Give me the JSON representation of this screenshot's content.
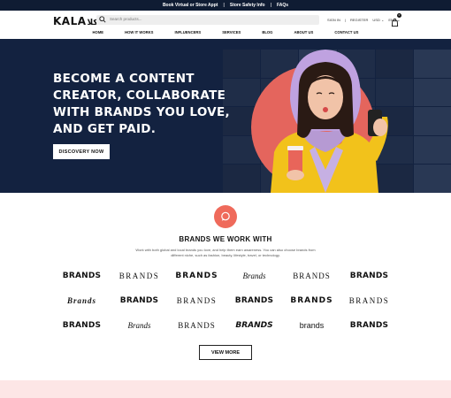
{
  "topbar": {
    "link1": "Book Virtual or Store Appt",
    "sep": "|",
    "link2": "Store Safety Info",
    "link3": "FAQs"
  },
  "header": {
    "logo": "KALA",
    "logo_arabic": "كلا",
    "search_placeholder": "Search products...",
    "signin": "SIGN IN",
    "register": "REGISTER",
    "currency": "USD ⌄",
    "language": "ENG ⌄",
    "cart_count": "0"
  },
  "nav": [
    "HOME",
    "HOW IT WORKS",
    "INFLUENCERS",
    "SERVICES",
    "BLOG",
    "ABOUT US",
    "CONTACT US"
  ],
  "hero": {
    "headline": "BECOME A CONTENT CREATOR, COLLABORATE WITH BRANDS YOU LOVE, AND GET PAID.",
    "button": "DISCOVERY NOW"
  },
  "brands_section": {
    "title": "BRANDS WE WORK WITH",
    "description": "Work with both global and local brands you love, and help them earn awareness. You can also choose brands from different niche, such as fashion, beauty, lifestyle, travel, or technology.",
    "logos": [
      "BRANDS",
      "BRANDS",
      "BRANDS",
      "Brands",
      "BRANDS",
      "BRANDS",
      "Brands",
      "BRANDS",
      "BRANDS",
      "BRANDS",
      "BRANDS",
      "BRANDS",
      "BRANDS",
      "Brands",
      "BRANDS",
      "BRANDS",
      "brands",
      "BRANDS"
    ],
    "view_more": "VIEW MORE"
  },
  "colors": {
    "navy": "#132240",
    "coral": "#ef6a5b",
    "pink_band": "#fde6e6"
  }
}
